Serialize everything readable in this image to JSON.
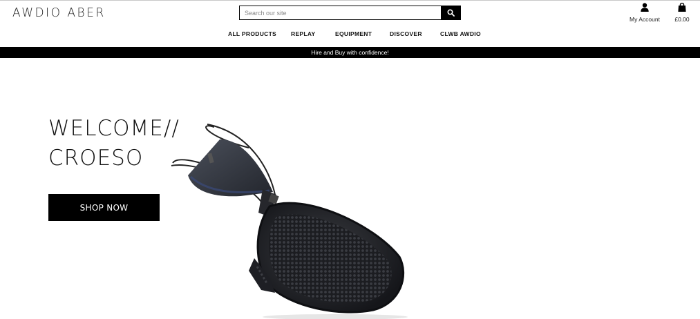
{
  "header": {
    "logo_text": "AWDIO ABER",
    "search": {
      "placeholder": "Search our site",
      "value": ""
    },
    "account_label": "My Account",
    "cart_total": "£0.00"
  },
  "nav": {
    "items": [
      {
        "label": "ALL PRODUCTS"
      },
      {
        "label": "REPLAY"
      },
      {
        "label": "EQUIPMENT"
      },
      {
        "label": "DISCOVER"
      },
      {
        "label": "CLWB AWDIO"
      }
    ]
  },
  "banner": {
    "text": "Hire and Buy with confidence!"
  },
  "hero": {
    "title_line1": "WELCOME//",
    "title_line2": "CROESO",
    "cta_label": "SHOP NOW",
    "image_icon": "headphones-product-image"
  },
  "colors": {
    "primary": "#000000",
    "background": "#ffffff",
    "text": "#111111"
  }
}
